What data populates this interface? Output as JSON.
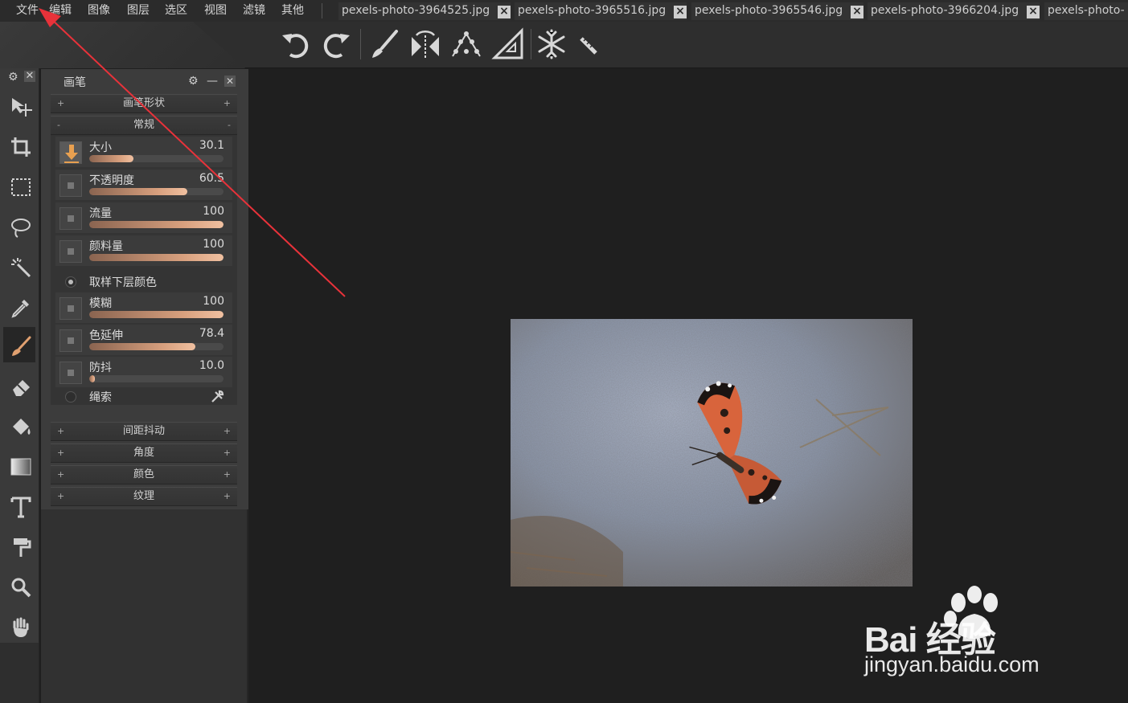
{
  "menu": [
    "文件",
    "编辑",
    "图像",
    "图层",
    "选区",
    "视图",
    "滤镜",
    "其他"
  ],
  "tabs": [
    {
      "name": "pexels-photo-3964525.jpg",
      "close": "×"
    },
    {
      "name": "pexels-photo-3965516.jpg",
      "close": "×"
    },
    {
      "name": "pexels-photo-3965546.jpg",
      "close": "×"
    },
    {
      "name": "pexels-photo-3966204.jpg",
      "close": "×"
    },
    {
      "name": "pexels-photo-",
      "close": ""
    }
  ],
  "toolbar_icons": [
    "undo-icon",
    "redo-icon",
    "brush-icon",
    "symmetry-icon",
    "scatter-icon",
    "ruler-triangle-icon",
    "snowflake-pattern-icon",
    "ruler-icon"
  ],
  "tools": [
    "move-icon",
    "crop-icon",
    "marquee-icon",
    "lasso-icon",
    "magic-wand-icon",
    "eyedropper-icon",
    "brush-icon",
    "eraser-icon",
    "paint-bucket-icon",
    "gradient-icon",
    "text-icon",
    "clone-icon",
    "zoom-icon",
    "hand-icon"
  ],
  "panel": {
    "title": "画笔",
    "settings": "⚙",
    "minimize": "—",
    "close": "✕",
    "tool_settings": "⚙",
    "tool_close": "✕",
    "sections_top": [
      {
        "label": "画笔形状",
        "left": "+",
        "right": "+"
      },
      {
        "label": "常规",
        "left": "-",
        "right": "-"
      }
    ],
    "rows": [
      {
        "label": "大小",
        "value": "30.1",
        "fill": 0.33
      },
      {
        "label": "不透明度",
        "value": "60.5",
        "fill": 0.73
      },
      {
        "label": "流量",
        "value": "100",
        "fill": 1.0
      },
      {
        "label": "颜料量",
        "value": "100",
        "fill": 1.0
      },
      {
        "label": "模糊",
        "value": "100",
        "fill": 1.0
      },
      {
        "label": "色延伸",
        "value": "78.4",
        "fill": 0.79
      },
      {
        "label": "防抖",
        "value": "10.0",
        "fill": 0.04
      }
    ],
    "sample_layer_label": "取样下层颜色",
    "lasso_label": "绳索",
    "sections_bottom": [
      {
        "label": "间距抖动",
        "left": "+",
        "right": "+"
      },
      {
        "label": "角度",
        "left": "+",
        "right": "+"
      },
      {
        "label": "颜色",
        "left": "+",
        "right": "+"
      },
      {
        "label": "纹理",
        "left": "+",
        "right": "+"
      }
    ]
  },
  "watermark": {
    "brand": "Bai  经验",
    "url": "jingyan.baidu.com"
  },
  "colors": {
    "accent": "#d8a07e",
    "arrow": "#e8323a"
  }
}
